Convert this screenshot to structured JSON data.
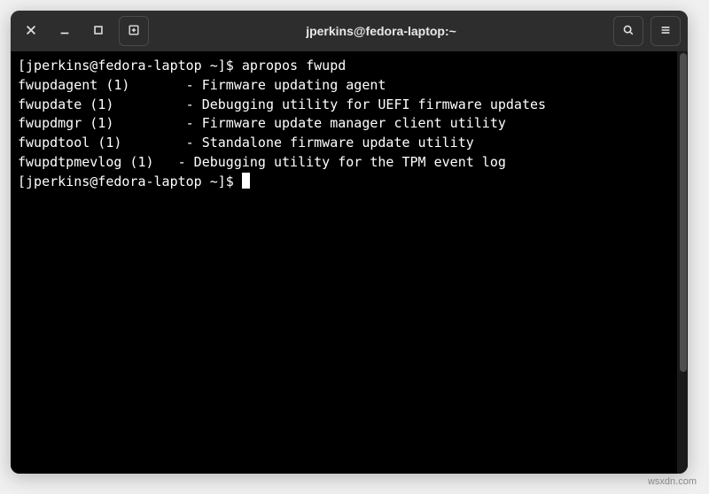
{
  "window": {
    "title": "jperkins@fedora-laptop:~"
  },
  "titlebar": {
    "close_name": "close-icon",
    "minimize_name": "minimize-icon",
    "maximize_name": "maximize-icon",
    "newtab_name": "new-tab-icon",
    "search_name": "search-icon",
    "menu_name": "hamburger-menu-icon"
  },
  "terminal": {
    "prompt_open": "[jperkins@fedora-laptop ~]$ ",
    "command": "apropos fwupd",
    "results": [
      {
        "name": "fwupdagent (1)",
        "pad": "       ",
        "desc": "- Firmware updating agent"
      },
      {
        "name": "fwupdate (1)",
        "pad": "         ",
        "desc": "- Debugging utility for UEFI firmware updates"
      },
      {
        "name": "fwupdmgr (1)",
        "pad": "         ",
        "desc": "- Firmware update manager client utility"
      },
      {
        "name": "fwupdtool (1)",
        "pad": "        ",
        "desc": "- Standalone firmware update utility"
      },
      {
        "name": "fwupdtpmevlog (1)",
        "pad": "   ",
        "desc": "- Debugging utility for the TPM event log"
      }
    ],
    "prompt_close": "[jperkins@fedora-laptop ~]$ "
  },
  "watermark": "wsxdn.com"
}
